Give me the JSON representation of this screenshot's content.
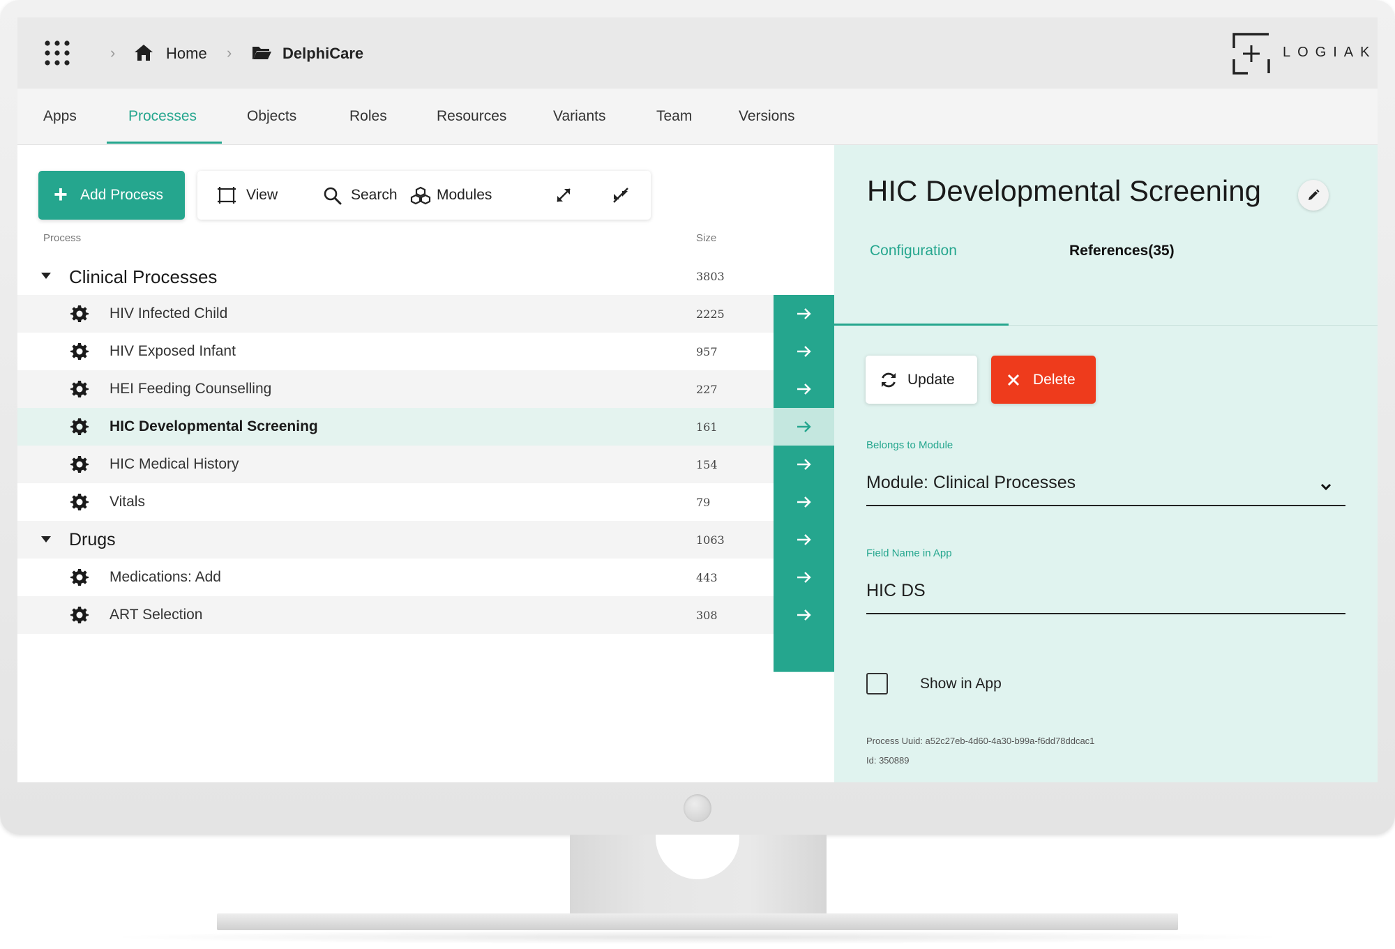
{
  "breadcrumb": {
    "home_label": "Home",
    "project_label": "DelphiCare",
    "icons": [
      "apps-grid-icon",
      "home-icon",
      "folder-icon"
    ]
  },
  "brand": {
    "name": "LOGIAK",
    "icon": "plus-bracket-logo"
  },
  "nav_tabs": [
    {
      "label": "Apps"
    },
    {
      "label": "Processes",
      "active": true
    },
    {
      "label": "Objects"
    },
    {
      "label": "Roles"
    },
    {
      "label": "Resources"
    },
    {
      "label": "Variants"
    },
    {
      "label": "Team"
    },
    {
      "label": "Versions"
    }
  ],
  "toolbar": {
    "add_label": "Add Process",
    "view_label": "View",
    "search_label": "Search",
    "modules_label": "Modules",
    "icons": [
      "plus-icon",
      "view-frame-icon",
      "search-icon",
      "modules-icon",
      "expand-icon",
      "collapse-icon"
    ]
  },
  "table": {
    "col_process": "Process",
    "col_size": "Size",
    "groups": [
      {
        "name": "Clinical Processes",
        "size": "3803",
        "items": [
          {
            "name": "HIV Infected Child",
            "size": "2225"
          },
          {
            "name": "HIV Exposed Infant",
            "size": "957"
          },
          {
            "name": "HEI Feeding Counselling",
            "size": "227"
          },
          {
            "name": "HIC Developmental Screening",
            "size": "161",
            "selected": true
          },
          {
            "name": "HIC Medical History",
            "size": "154"
          },
          {
            "name": "Vitals",
            "size": "79"
          }
        ]
      },
      {
        "name": "Drugs",
        "size": "1063",
        "items": [
          {
            "name": "Medications: Add",
            "size": "443"
          },
          {
            "name": "ART Selection",
            "size": "308"
          }
        ]
      }
    ]
  },
  "detail": {
    "title": "HIC Developmental Screening",
    "tabs": {
      "configuration": "Configuration",
      "references": "References(35)"
    },
    "update_label": "Update",
    "delete_label": "Delete",
    "module_label": "Belongs to Module",
    "module_value": "Module: Clinical Processes",
    "field_name_label": "Field Name in App",
    "field_name_value": "HIC DS",
    "show_in_app_label": "Show in App",
    "show_in_app_checked": false,
    "uuid_text": "Process Uuid: a52c27eb-4d60-4a30-b99a-f6dd78ddcac1",
    "id_text": "Id: 350889"
  },
  "colors": {
    "accent": "#25a68e",
    "danger": "#ee3b1c",
    "detail_bg": "#e0f3ef",
    "selected_row": "#e4f3ef"
  }
}
